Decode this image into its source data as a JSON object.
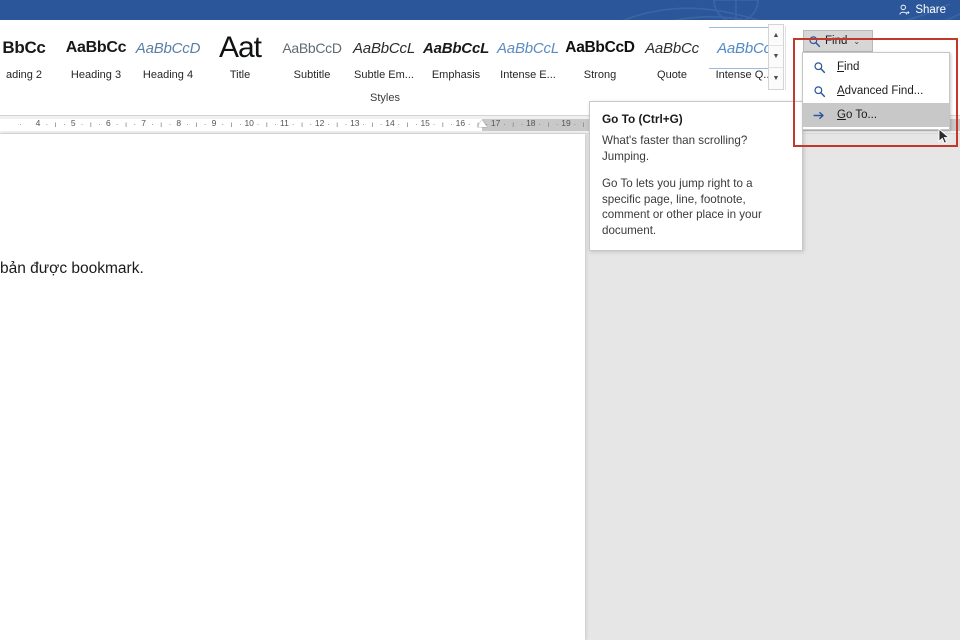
{
  "titlebar": {
    "share_label": "Share",
    "share_icon": "person-share-icon",
    "bg_color": "#2b579a"
  },
  "ribbon": {
    "styles_group": {
      "label": "Styles",
      "items": [
        {
          "preview": "BbCc",
          "name": "ading 2",
          "style": "p-h2"
        },
        {
          "preview": "AaBbCc",
          "name": "Heading 3",
          "style": "p-h3"
        },
        {
          "preview": "AaBbCcD",
          "name": "Heading 4",
          "style": "p-h4"
        },
        {
          "preview": "Aat",
          "name": "Title",
          "style": "p-title"
        },
        {
          "preview": "AaBbCcD",
          "name": "Subtitle",
          "style": "p-sub"
        },
        {
          "preview": "AaBbCcL",
          "name": "Subtle Em...",
          "style": "p-subem"
        },
        {
          "preview": "AaBbCcL",
          "name": "Emphasis",
          "style": "p-emph"
        },
        {
          "preview": "AaBbCcL",
          "name": "Intense E...",
          "style": "p-intense"
        },
        {
          "preview": "AaBbCcD",
          "name": "Strong",
          "style": "p-strong"
        },
        {
          "preview": "AaBbCc",
          "name": "Quote",
          "style": "p-quote"
        },
        {
          "preview": "AaBbCc",
          "name": "Intense Q...",
          "style": "p-iquote"
        }
      ],
      "scroll_up": "▲",
      "scroll_down": "▼",
      "scroll_more": "▼"
    },
    "editing_group": {
      "find_button": {
        "label": "Find",
        "icon": "magnifier-icon",
        "caret": "⌄"
      },
      "menu": [
        {
          "label_pre": "",
          "accel": "F",
          "label_post": "ind",
          "icon": "magnifier-icon",
          "selected": false,
          "name": "Find"
        },
        {
          "label_pre": "",
          "accel": "A",
          "label_post": "dvanced Find...",
          "icon": "magnifier-icon",
          "selected": false,
          "name": "Advanced Find..."
        },
        {
          "label_pre": "",
          "accel": "G",
          "label_post": "o To...",
          "icon": "arrow-right-icon",
          "selected": true,
          "name": "Go To..."
        }
      ]
    },
    "highlight_color": "#c0392b"
  },
  "ruler": {
    "ticks": [
      "4",
      "5",
      "6",
      "7",
      "8",
      "9",
      "10",
      "11",
      "12",
      "13",
      "14",
      "15",
      "16",
      "17",
      "18",
      "19"
    ],
    "indent_marker": "first-line-indent-marker"
  },
  "document": {
    "text": "bản được bookmark."
  },
  "tooltip": {
    "title": "Go To (Ctrl+G)",
    "paragraphs": [
      "What's faster than scrolling? Jumping.",
      "Go To lets you jump right to a specific page, line, footnote, comment or other place in your document."
    ]
  }
}
